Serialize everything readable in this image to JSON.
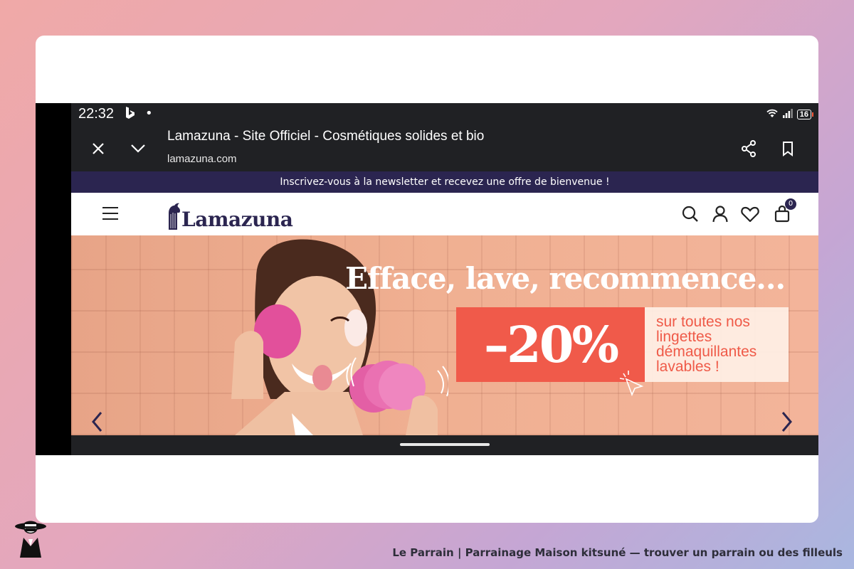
{
  "status_bar": {
    "time": "22:32",
    "app_icon": "bing-icon",
    "dot": "•",
    "battery": "16",
    "colors": {
      "battery_tip": "#ff5a3c"
    }
  },
  "browser": {
    "page_title": "Lamazuna - Site Officiel - Cosmétiques solides et bio",
    "url": "lamazuna.com",
    "icons": [
      "close-icon",
      "chevron-down-icon",
      "share-icon",
      "bookmark-icon",
      "more-vert-icon"
    ]
  },
  "site": {
    "newsletter": "Inscrivez-vous à la newsletter et recevez une offre de bienvenue !",
    "logo": "Lamazuna",
    "cart_count": "0",
    "colors": {
      "brand": "#2b2550",
      "promo": "#f05a4a"
    }
  },
  "hero": {
    "headline": "Efface, lave, recommence...",
    "discount": "–20%",
    "promo_lines": [
      "sur toutes nos",
      "lingettes",
      "démaquillantes",
      "lavables !"
    ]
  },
  "footer": {
    "caption": "Le Parrain | Parrainage Maison kitsuné — trouver un parrain ou des filleuls"
  }
}
